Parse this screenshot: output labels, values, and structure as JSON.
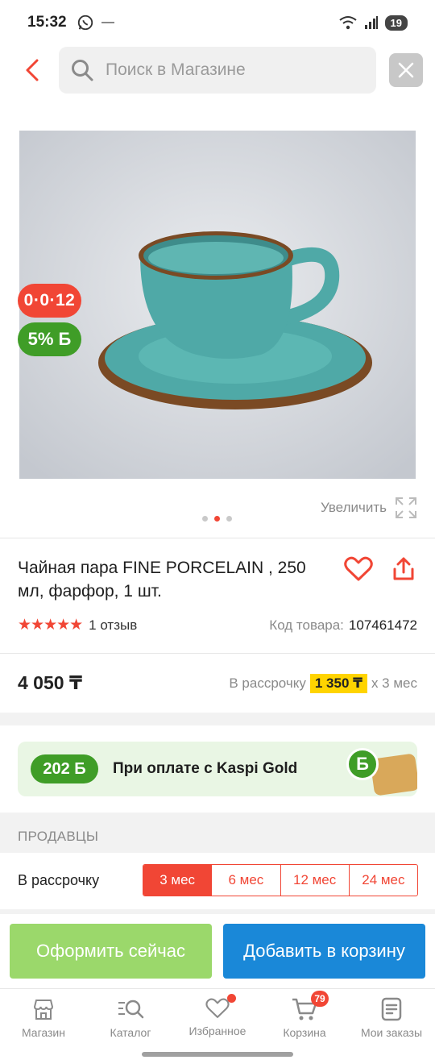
{
  "status_bar": {
    "time": "15:32",
    "battery": "19"
  },
  "search": {
    "placeholder": "Поиск в Магазине"
  },
  "product": {
    "badge_installment": "0·0·12",
    "badge_bonus": "5% Б",
    "zoom_label": "Увеличить",
    "image_count": 3,
    "active_image_index": 2,
    "title": "Чайная пара FINE PORCELAIN , 250 мл, фарфор, 1 шт.",
    "rating": 5,
    "stars": "★★★★★",
    "reviews": "1 отзыв",
    "sku_label": "Код товара:",
    "sku_value": "107461472",
    "price": "4 050 ₸",
    "installment_label": "В рассрочку",
    "installment_amount": "1 350 ₸",
    "installment_tail": "x 3 мес"
  },
  "kaspi_gold": {
    "bonus": "202 Б",
    "text": "При оплате с Kaspi Gold",
    "b_symbol": "Б"
  },
  "sellers": {
    "section_label": "ПРОДАВЦЫ",
    "installment_label": "В рассрочку",
    "terms": [
      {
        "label": "3 мес"
      },
      {
        "label": "6 мес"
      },
      {
        "label": "12 мес"
      },
      {
        "label": "24 мес"
      }
    ],
    "active_term": 0
  },
  "actions": {
    "buy_now": "Оформить сейчас",
    "add_to_cart": "Добавить в корзину"
  },
  "nav": {
    "items": [
      {
        "label": "Магазин",
        "icon": "store-icon"
      },
      {
        "label": "Каталог",
        "icon": "catalog-search-icon"
      },
      {
        "label": "Избранное",
        "icon": "heart-icon"
      },
      {
        "label": "Корзина",
        "icon": "cart-icon"
      },
      {
        "label": "Мои заказы",
        "icon": "orders-icon"
      }
    ],
    "cart_count": "79"
  },
  "colors": {
    "accent": "#f14635",
    "green": "#3f9d27",
    "blue": "#1a88d8",
    "yellow": "#ffd400"
  }
}
